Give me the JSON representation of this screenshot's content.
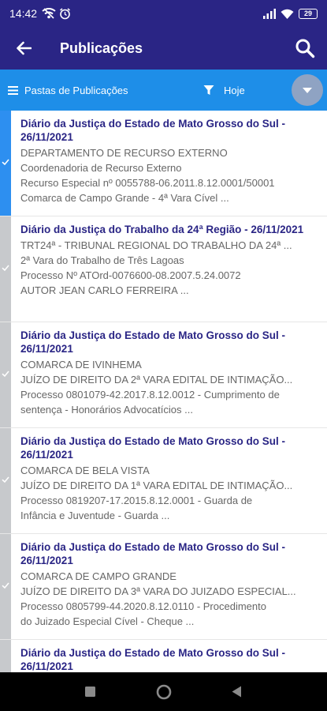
{
  "status_bar": {
    "time": "14:42",
    "battery": "29",
    "icons": [
      "wifi-off-icon",
      "alarm-icon",
      "signal-icon",
      "wifi-icon",
      "battery-icon"
    ]
  },
  "app_bar": {
    "title": "Publicações",
    "back_icon": "arrow-left-icon",
    "search_icon": "search-icon"
  },
  "filter_bar": {
    "folders_label": "Pastas de Publicações",
    "date_label": "Hoje",
    "menu_icon": "hamburger-icon",
    "filter_icon": "funnel-icon",
    "expand_icon": "chevron-down-icon"
  },
  "publications": [
    {
      "title": "Diário da Justiça do Estado de Mato Grosso do Sul - 26/11/2021",
      "lines": [
        "DEPARTAMENTO DE RECURSO EXTERNO",
        "Coordenadoria de Recurso Externo",
        "Recurso Especial nº 0055788-06.2011.8.12.0001/50001",
        "Comarca de Campo Grande - 4ª Vara Cível ..."
      ],
      "active": true
    },
    {
      "title": "Diário da Justiça do Trabalho da 24ª Região - 26/11/2021",
      "lines": [
        "TRT24ª - TRIBUNAL REGIONAL DO TRABALHO DA 24ª ...",
        "2ª Vara do Trabalho de Três Lagoas",
        "Processo Nº ATOrd-0076600-08.2007.5.24.0072",
        "AUTOR JEAN CARLO FERREIRA ..."
      ],
      "active": false
    },
    {
      "title": "Diário da Justiça do Estado de Mato Grosso do Sul - 26/11/2021",
      "lines": [
        "COMARCA DE IVINHEMA",
        "JUÍZO DE DIREITO DA 2ª VARA EDITAL DE INTIMAÇÃO...",
        "Processo 0801079-42.2017.8.12.0012 - Cumprimento de",
        "sentença - Honorários Advocatícios ..."
      ],
      "active": false
    },
    {
      "title": "Diário da Justiça do Estado de Mato Grosso do Sul - 26/11/2021",
      "lines": [
        "COMARCA DE BELA VISTA",
        "JUÍZO DE DIREITO DA 1ª VARA EDITAL DE INTIMAÇÃO...",
        "Processo 0819207-17.2015.8.12.0001 - Guarda de",
        "Infância e Juventude - Guarda ..."
      ],
      "active": false
    },
    {
      "title": "Diário da Justiça do Estado de Mato Grosso do Sul - 26/11/2021",
      "lines": [
        "COMARCA DE CAMPO GRANDE",
        "JUÍZO DE DIREITO DA 3ª VARA DO JUIZADO ESPECIAL...",
        "Processo 0805799-44.2020.8.12.0110 - Procedimento",
        "do Juizado Especial Cível - Cheque ..."
      ],
      "active": false
    },
    {
      "title": "Diário da Justiça do Estado de Mato Grosso do Sul - 26/11/2021",
      "lines": [],
      "active": false
    }
  ],
  "nav_bar": {
    "icons": [
      "recents-icon",
      "home-icon",
      "back-icon"
    ]
  },
  "colors": {
    "app_bar": "#2a2585",
    "filter_bar": "#1e8ee8",
    "headline": "#2a2585",
    "active_stripe": "#2d8ff0",
    "inactive_stripe": "#c7c9cc"
  }
}
